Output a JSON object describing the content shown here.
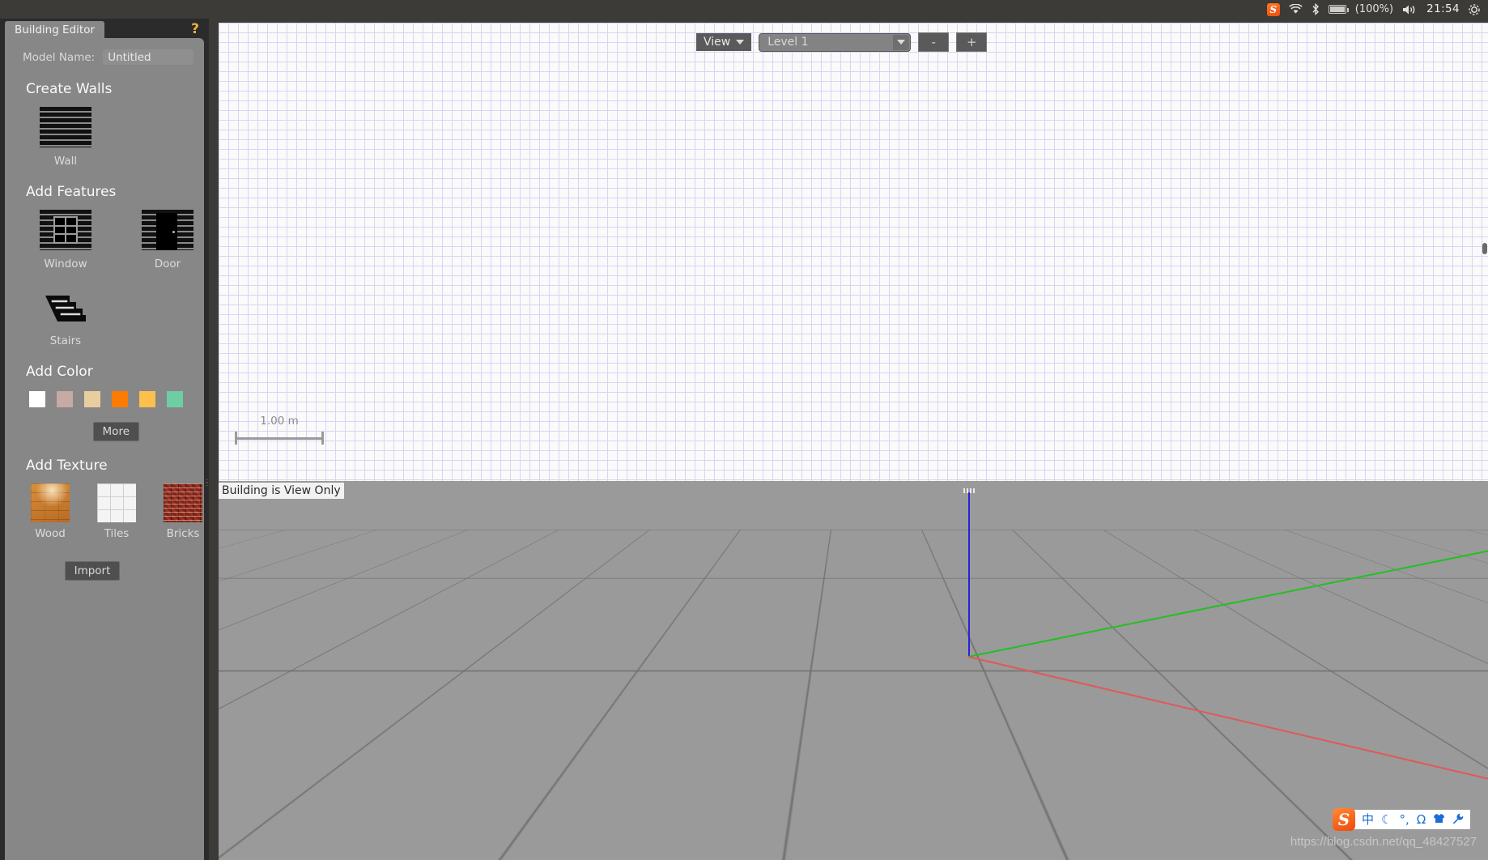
{
  "topbar": {
    "tray": [
      {
        "name": "sogou-ime-icon",
        "glyph": "S"
      },
      {
        "name": "wifi-icon",
        "glyph": "◑"
      },
      {
        "name": "bluetooth-icon",
        "glyph": "෴"
      },
      {
        "name": "battery-icon",
        "glyph": ""
      },
      {
        "name": "volume-icon",
        "glyph": "🔊"
      },
      {
        "name": "system-menu-icon",
        "glyph": "⚙"
      }
    ],
    "battery_label": "(100%)",
    "clock": "21:54"
  },
  "panel": {
    "tab_label": "Building Editor",
    "help_label": "?",
    "model_name_label": "Model Name:",
    "model_name_value": "Untitled",
    "model_name_placeholder": "Untitled",
    "sections": {
      "create_walls": {
        "title": "Create Walls",
        "tools": [
          {
            "label": "Wall",
            "icon": "brick-wall-icon"
          }
        ]
      },
      "add_features": {
        "title": "Add Features",
        "tools": [
          {
            "label": "Window",
            "icon": "window-icon"
          },
          {
            "label": "Door",
            "icon": "door-icon"
          },
          {
            "label": "Stairs",
            "icon": "stairs-icon"
          }
        ]
      },
      "add_color": {
        "title": "Add Color",
        "more_label": "More",
        "swatches": [
          {
            "name": "color-white",
            "hex": "#ffffff"
          },
          {
            "name": "color-dusty-pink",
            "hex": "#c8a9a3"
          },
          {
            "name": "color-tan",
            "hex": "#e8cd9e"
          },
          {
            "name": "color-orange",
            "hex": "#fc7b02"
          },
          {
            "name": "color-amber",
            "hex": "#fdc04b"
          },
          {
            "name": "color-mint",
            "hex": "#6fcda5"
          }
        ]
      },
      "add_texture": {
        "title": "Add Texture",
        "import_label": "Import",
        "textures": [
          {
            "label": "Wood",
            "icon": "wood-texture-icon"
          },
          {
            "label": "Tiles",
            "icon": "tiles-texture-icon"
          },
          {
            "label": "Bricks",
            "icon": "bricks-texture-icon"
          }
        ]
      }
    }
  },
  "view2d": {
    "view_button_label": "View",
    "level_value": "Level 1",
    "level_down_label": "-",
    "level_up_label": "+",
    "scale_label": "1.00 m"
  },
  "view3d": {
    "status_label": "Building is View Only",
    "axes": {
      "x": "#e35757",
      "y": "#22c022",
      "z": "#2424d8"
    }
  },
  "ime": {
    "logo": "S",
    "items": [
      {
        "name": "ime-chinese-mode-icon",
        "glyph": "中"
      },
      {
        "name": "ime-moon-icon",
        "glyph": "☾"
      },
      {
        "name": "ime-degree-icon",
        "glyph": "°,"
      },
      {
        "name": "ime-omega-icon",
        "glyph": "Ω"
      },
      {
        "name": "ime-skin-icon",
        "glyph": "👕"
      },
      {
        "name": "ime-tools-icon",
        "glyph": "🔧"
      }
    ]
  },
  "watermark": "https://blog.csdn.net/qq_48427527"
}
